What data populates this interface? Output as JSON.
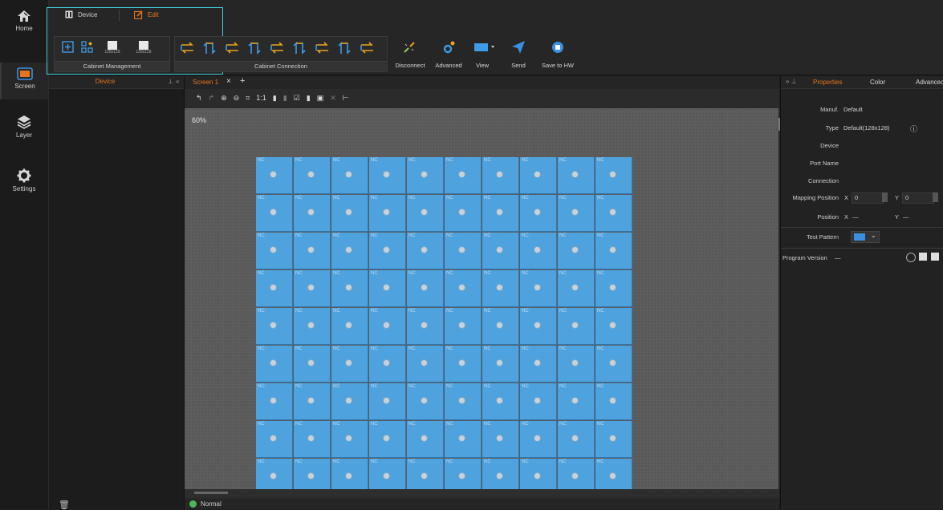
{
  "nav": {
    "home": "Home",
    "screen": "Screen",
    "layer": "Layer",
    "settings": "Settings"
  },
  "toolbar": {
    "tab_device": "Device",
    "tab_edit": "Edit",
    "cabinet_management_label": "Cabinet Management",
    "cabinet_connection_label": "Cabinet Connection",
    "size_a": "128x128",
    "size_b": "128x128",
    "disconnect": "Disconnect",
    "advanced": "Advanced",
    "view": "View",
    "send": "Send",
    "save_to_hw": "Save to HW"
  },
  "device_panel": {
    "title": "Device"
  },
  "screen_tab": {
    "name": "Screen 1",
    "zoom": "60%",
    "status": "Normal"
  },
  "cabinet": {
    "label": "NC",
    "cols": 10,
    "rows": 9
  },
  "properties": {
    "tabs": [
      "Properties",
      "Color",
      "Advanced"
    ],
    "manuf_label": "Manuf.",
    "manuf_value": "Default",
    "type_label": "Type",
    "type_value": "Default(128x128)",
    "device_label": "Device",
    "port_name_label": "Port Name",
    "connection_label": "Connection",
    "mapping_position_label": "Mapping Position",
    "mapping_x_label": "X",
    "mapping_x_value": "0",
    "mapping_y_label": "Y",
    "mapping_y_value": "0",
    "position_label": "Position",
    "position_x_label": "X",
    "position_x_value": "—",
    "position_y_label": "Y",
    "position_y_value": "—",
    "test_pattern_label": "Test Pattern",
    "program_version_label": "Program Version",
    "program_version_value": "—"
  },
  "colors": {
    "accent_orange": "#e8741c",
    "highlight_cyan": "#3fd6e0",
    "cabinet_blue": "#4ea3de",
    "send_blue": "#3a8fe0"
  }
}
